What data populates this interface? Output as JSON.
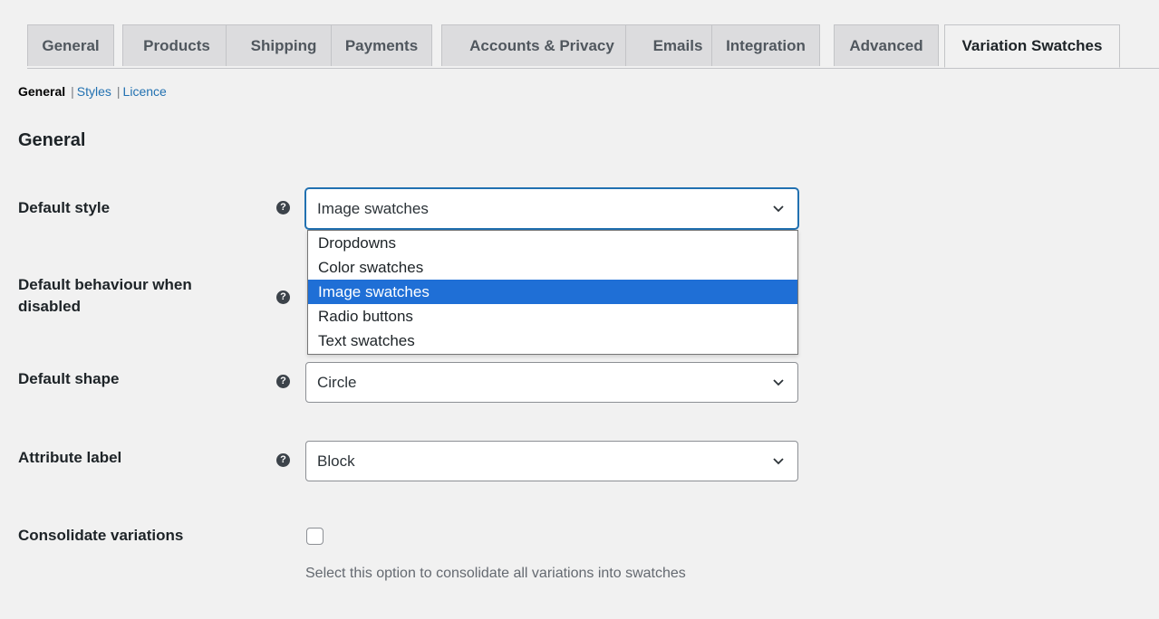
{
  "tabs": [
    {
      "label": "General"
    },
    {
      "label": "Products"
    },
    {
      "label": "Shipping"
    },
    {
      "label": "Payments"
    },
    {
      "label": "Accounts & Privacy"
    },
    {
      "label": "Emails"
    },
    {
      "label": "Integration"
    },
    {
      "label": "Advanced"
    },
    {
      "label": "Variation Swatches",
      "active": true
    }
  ],
  "subnav": {
    "current": "General",
    "separator": "|",
    "links": [
      "Styles",
      "Licence"
    ]
  },
  "section_title": "General",
  "help_glyph": "?",
  "fields": {
    "default_style": {
      "label": "Default style",
      "value": "Image swatches",
      "options": [
        "Dropdowns",
        "Color swatches",
        "Image swatches",
        "Radio buttons",
        "Text swatches"
      ]
    },
    "default_behaviour": {
      "label_line1": "Default behaviour when",
      "label_line2": "disabled"
    },
    "default_shape": {
      "label": "Default shape",
      "value": "Circle"
    },
    "attribute_label": {
      "label": "Attribute label",
      "value": "Block"
    },
    "consolidate": {
      "label": "Consolidate variations",
      "checked": false,
      "description": "Select this option to consolidate all variations into swatches"
    }
  },
  "colors": {
    "background": "#f1f1f1",
    "link": "#2271b1",
    "selected_option": "#1f6fd6"
  }
}
